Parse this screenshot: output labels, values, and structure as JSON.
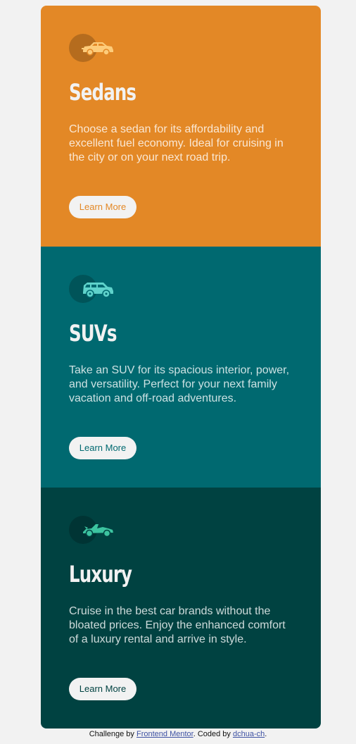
{
  "cards": [
    {
      "icon": "sedan-icon",
      "title": "Sedans",
      "description": "Choose a sedan for its affordability and excellent fuel economy. Ideal for cruising in the city or on your next road trip.",
      "button": "Learn More",
      "color": "#e38826"
    },
    {
      "icon": "suv-icon",
      "title": "SUVs",
      "description": "Take an SUV for its spacious interior, power, and versatility. Perfect for your next family vacation and off-road adventures.",
      "button": "Learn More",
      "color": "#006970"
    },
    {
      "icon": "luxury-car-icon",
      "title": "Luxury",
      "description": "Cruise in the best car brands without the bloated prices. Enjoy the enhanced comfort of a luxury rental and arrive in style.",
      "button": "Learn More",
      "color": "#004241"
    }
  ],
  "attribution": {
    "prefix": "Challenge by ",
    "link1": "Frontend Mentor",
    "middle": ". Coded by ",
    "link2": "dchua-ch",
    "suffix": "."
  },
  "colors": {
    "background": "#f2f2f2",
    "sedans": "#e38826",
    "suvs": "#006970",
    "luxury": "#004241",
    "link": "#3e52a3"
  }
}
